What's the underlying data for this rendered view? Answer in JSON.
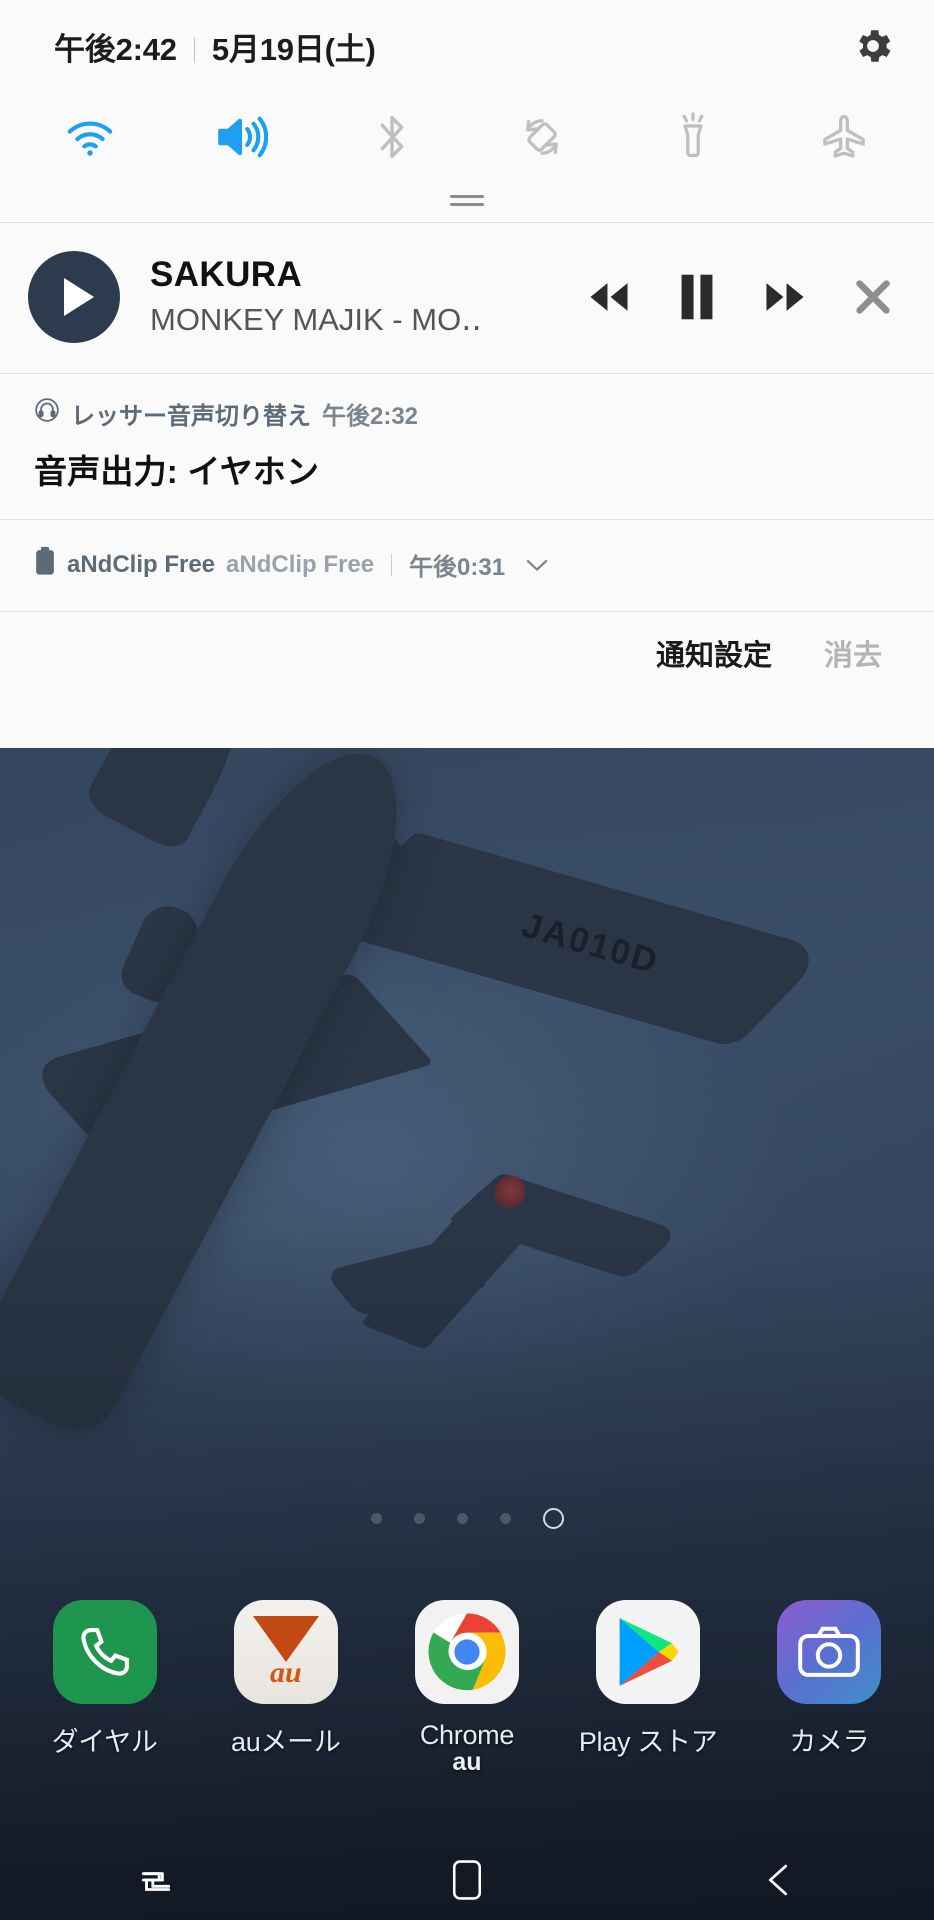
{
  "status_bar": {
    "time": "午後2:42",
    "date": "5月19日(土)",
    "settings_icon": "gear-icon"
  },
  "quick_settings": {
    "tiles": [
      {
        "name": "wifi-tile",
        "icon": "wifi-icon",
        "state": "on",
        "color": "#2196f3"
      },
      {
        "name": "sound-tile",
        "icon": "volume-icon",
        "state": "on",
        "color": "#2196f3"
      },
      {
        "name": "bluetooth-tile",
        "icon": "bluetooth-icon",
        "state": "off",
        "color": "#bdbdbd"
      },
      {
        "name": "rotate-tile",
        "icon": "auto-rotate-icon",
        "state": "off",
        "color": "#bdbdbd"
      },
      {
        "name": "flashlight-tile",
        "icon": "flashlight-icon",
        "state": "off",
        "color": "#bdbdbd"
      },
      {
        "name": "airplane-tile",
        "icon": "airplane-icon",
        "state": "off",
        "color": "#bdbdbd"
      }
    ]
  },
  "notifications": {
    "media": {
      "title": "SAKURA",
      "subtitle": "MONKEY MAJIK - MO‥",
      "album_art_icon": "play-circle-icon",
      "controls": [
        {
          "name": "rewind-button",
          "icon": "rewind-icon"
        },
        {
          "name": "pause-button",
          "icon": "pause-icon"
        },
        {
          "name": "fast-forward-button",
          "icon": "fast-forward-icon"
        },
        {
          "name": "close-button",
          "icon": "close-icon"
        }
      ]
    },
    "audio_switch": {
      "app_name": "レッサー音声切り替え",
      "timestamp": "午後2:32",
      "body": "音声出力: イヤホン",
      "app_icon": "headphone-icon"
    },
    "andclip": {
      "app_name": "aNdClip Free",
      "title": "aNdClip Free",
      "timestamp": "午後0:31",
      "app_icon": "clipboard-icon",
      "expand_icon": "chevron-down-icon"
    }
  },
  "shade_actions": {
    "settings_label": "通知設定",
    "clear_label": "消去"
  },
  "home": {
    "page_dots": {
      "count": 5,
      "active_index": 4
    },
    "dock": [
      {
        "label": "ダイヤル",
        "icon": "phone-icon"
      },
      {
        "label": "auメール",
        "icon": "au-mail-icon",
        "wordmark": "au"
      },
      {
        "label": "Chrome",
        "icon": "chrome-icon",
        "badge": "au"
      },
      {
        "label": "Play ストア",
        "icon": "play-store-icon"
      },
      {
        "label": "カメラ",
        "icon": "camera-icon"
      }
    ],
    "chrome_badge": "au",
    "wallpaper": {
      "registration": "JA010D"
    }
  },
  "nav_bar": {
    "buttons": [
      {
        "name": "recents-button",
        "icon": "recents-icon"
      },
      {
        "name": "home-button",
        "icon": "home-square-icon"
      },
      {
        "name": "back-button",
        "icon": "back-arrow-icon"
      }
    ]
  },
  "colors": {
    "accent": "#2196f3",
    "shade_bg": "#fafafa",
    "text_primary": "#111111",
    "text_muted": "#9aa3ab"
  }
}
